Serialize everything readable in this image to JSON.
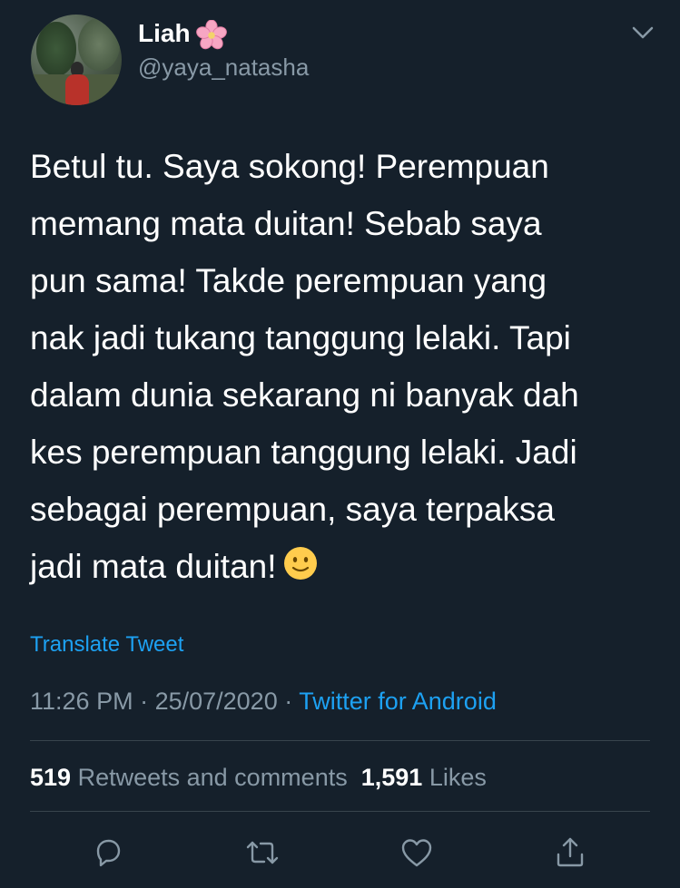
{
  "user": {
    "name": "Liah",
    "name_emoji": "cherry-blossom",
    "handle": "@yaya_natasha"
  },
  "tweet": {
    "text": "Betul tu. Saya sokong! Perempuan\nmemang mata duitan! Sebab saya\npun sama! Takde perempuan yang\nnak jadi tukang tanggung lelaki. Tapi\ndalam dunia sekarang ni banyak dah\nkes perempuan tanggung lelaki. Jadi\nsebagai perempuan, saya terpaksa\njadi mata duitan!",
    "trailing_emoji": "slightly-smiling-face",
    "translate_label": "Translate Tweet"
  },
  "meta": {
    "time": "11:26 PM",
    "separator": " · ",
    "date": "25/07/2020",
    "source": "Twitter for Android"
  },
  "stats": {
    "retweets_count": "519",
    "retweets_label": "Retweets and comments",
    "likes_count": "1,591",
    "likes_label": "Likes"
  },
  "actions": [
    "reply-icon",
    "retweet-icon",
    "like-icon",
    "share-icon"
  ],
  "colors": {
    "background": "#15202b",
    "text": "#ffffff",
    "secondary": "#8899a6",
    "accent": "#1da1f2",
    "divider": "#38444d"
  }
}
